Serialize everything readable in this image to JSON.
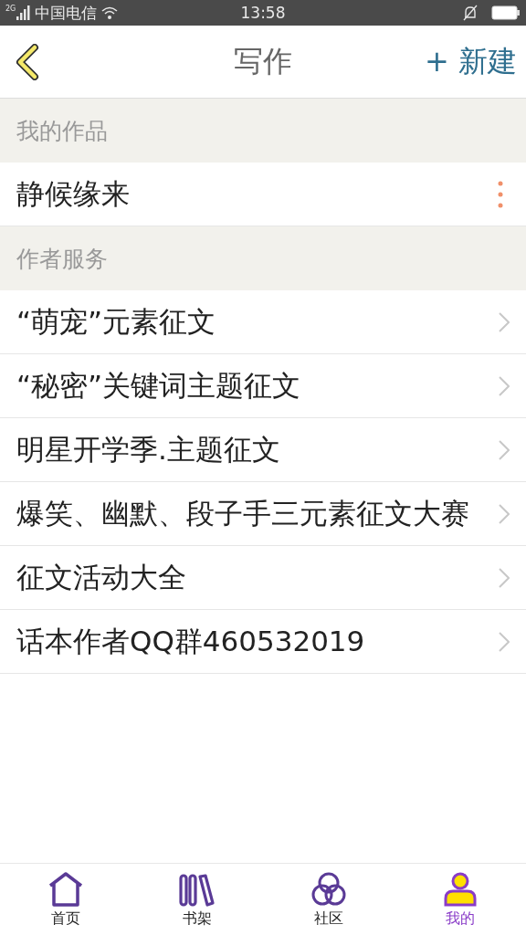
{
  "status_bar": {
    "network": "2G",
    "carrier": "中国电信",
    "time": "13:58"
  },
  "header": {
    "title": "写作",
    "action": "+ 新建"
  },
  "sections": [
    {
      "title": "我的作品",
      "items": [
        {
          "kind": "work",
          "label": "静候缘来"
        }
      ]
    },
    {
      "title": "作者服务",
      "items": [
        {
          "kind": "link",
          "label": "“萌宠”元素征文"
        },
        {
          "kind": "link",
          "label": "“秘密”关键词主题征文"
        },
        {
          "kind": "link",
          "label": "明星开学季.主题征文"
        },
        {
          "kind": "link",
          "label": "爆笑、幽默、段子手三元素征文大赛"
        },
        {
          "kind": "link",
          "label": "征文活动大全"
        },
        {
          "kind": "link",
          "label": "话本作者QQ群460532019"
        }
      ]
    }
  ],
  "tab_bar": [
    {
      "kind": "home",
      "label": "首页",
      "selected": false
    },
    {
      "kind": "shelf",
      "label": "书架",
      "selected": false
    },
    {
      "kind": "community",
      "label": "社区",
      "selected": false
    },
    {
      "kind": "me",
      "label": "我的",
      "selected": true
    }
  ]
}
